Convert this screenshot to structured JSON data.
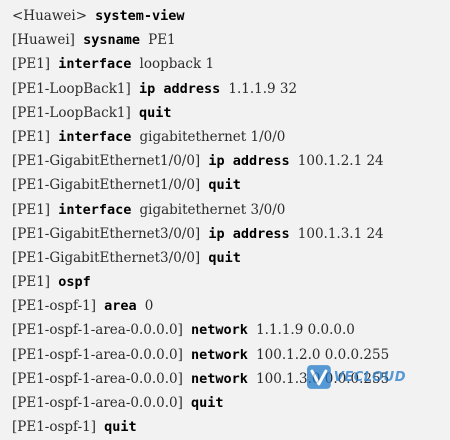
{
  "lines": [
    {
      "prompt": "<Huawei>",
      "cmd": "system-view",
      "arg": ""
    },
    {
      "prompt": "[Huawei]",
      "cmd": "sysname",
      "arg": "PE1"
    },
    {
      "prompt": "[PE1]",
      "cmd": "interface",
      "arg": "loopback 1"
    },
    {
      "prompt": "[PE1-LoopBack1]",
      "cmd": "ip address",
      "arg": "1.1.1.9 32"
    },
    {
      "prompt": "[PE1-LoopBack1]",
      "cmd": "quit",
      "arg": ""
    },
    {
      "prompt": "[PE1]",
      "cmd": "interface",
      "arg": "gigabitethernet 1/0/0"
    },
    {
      "prompt": "[PE1-GigabitEthernet1/0/0]",
      "cmd": "ip address",
      "arg": "100.1.2.1 24"
    },
    {
      "prompt": "[PE1-GigabitEthernet1/0/0]",
      "cmd": "quit",
      "arg": ""
    },
    {
      "prompt": "[PE1]",
      "cmd": "interface",
      "arg": "gigabitethernet 3/0/0"
    },
    {
      "prompt": "[PE1-GigabitEthernet3/0/0]",
      "cmd": "ip address",
      "arg": "100.1.3.1 24"
    },
    {
      "prompt": "[PE1-GigabitEthernet3/0/0]",
      "cmd": "quit",
      "arg": ""
    },
    {
      "prompt": "[PE1]",
      "cmd": "ospf",
      "arg": ""
    },
    {
      "prompt": "[PE1-ospf-1]",
      "cmd": "area",
      "arg": "0"
    },
    {
      "prompt": "[PE1-ospf-1-area-0.0.0.0]",
      "cmd": "network",
      "arg": "1.1.1.9 0.0.0.0"
    },
    {
      "prompt": "[PE1-ospf-1-area-0.0.0.0]",
      "cmd": "network",
      "arg": "100.1.2.0 0.0.0.255"
    },
    {
      "prompt": "[PE1-ospf-1-area-0.0.0.0]",
      "cmd": "network",
      "arg": "100.1.3.0 0.0.0.255"
    },
    {
      "prompt": "[PE1-ospf-1-area-0.0.0.0]",
      "cmd": "quit",
      "arg": ""
    },
    {
      "prompt": "[PE1-ospf-1]",
      "cmd": "quit",
      "arg": ""
    }
  ],
  "watermark": {
    "text": "VECLOUD",
    "icon": "v-logo-icon",
    "color": "#1a76c8"
  }
}
